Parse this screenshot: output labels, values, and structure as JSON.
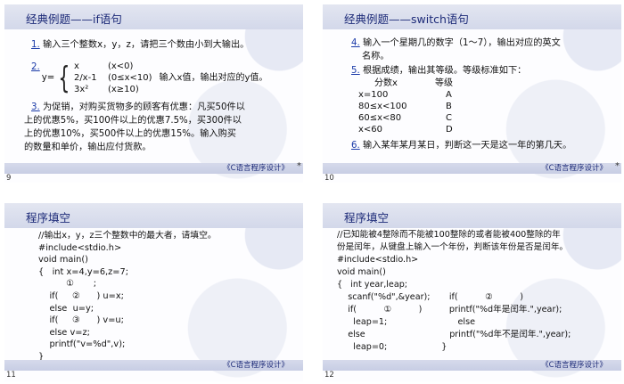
{
  "footer_text": "《C语言程序设计》",
  "star": "*",
  "slides": [
    {
      "page": "9",
      "title": "经典例题——if语句",
      "q1_num": "1.",
      "q1_text": "输入三个整数x，y，z，请把三个数由小到大输出。",
      "q2_num": "2.",
      "q2_y": "y=",
      "q2_rows": [
        {
          "expr": "x",
          "cond": "(x<0)"
        },
        {
          "expr": "2/x-1",
          "cond": "(0≤x<10)"
        },
        {
          "expr": "3x²",
          "cond": "(x≥10)"
        }
      ],
      "q2_tail": "输入x值，输出对应的y值。",
      "q3_num": "3.",
      "q3_lines": [
        "为促销，对购买货物多的顾客有优惠：凡买50件以",
        "上的优惠5%，买100件以上的优惠7.5%，买300件以",
        "上的优惠10%，买500件以上的优惠15%。输入购买",
        "的数量和单价，输出应付货款。"
      ]
    },
    {
      "page": "10",
      "title": "经典例题——switch语句",
      "q4_num": "4.",
      "q4_lines": [
        "输入一个星期几的数字（1～7），输出对应的英文",
        "名称。"
      ],
      "q5_num": "5.",
      "q5_text": "根据成绩，输出其等级。等级标准如下：",
      "table_header": [
        "分数x",
        "等级"
      ],
      "table_rows": [
        [
          "x=100",
          "A"
        ],
        [
          "80≤x<100",
          "B"
        ],
        [
          "60≤x<80",
          "C"
        ],
        [
          "x<60",
          "D"
        ]
      ],
      "q6_num": "6.",
      "q6_text": "输入某年某月某日，判断这一天是这一年的第几天。"
    },
    {
      "page": "11",
      "title": "程序填空",
      "code": [
        "//输出x，y，z三个整数中的最大者，请填空。",
        "#include<stdio.h>",
        "void main()",
        "{   int x=4,y=6,z=7;",
        "          ①       ;",
        "    if(     ②      ) u=x;",
        "    else  u=y;",
        "    if(     ③      ) v=u;",
        "    else v=z;",
        "    printf(\"v=%d\",v);",
        "}"
      ]
    },
    {
      "page": "12",
      "title": "程序填空",
      "code": [
        "//已知能被4整除而不能被100整除的或者能被400整除的年",
        "份是闰年，从键盘上输入一个年份，判断该年份是否是闰年。",
        "#include<stdio.h>",
        "void main()",
        "{   int year,leap;",
        "    scanf(\"%d\",&year);       if(          ②          )",
        "    if(          ①          )          printf(\"%d年是闰年.\",year);",
        "      leap=1;                          else",
        "    else                               printf(\"%d年不是闰年.\",year);",
        "      leap=0;                    }"
      ]
    }
  ]
}
